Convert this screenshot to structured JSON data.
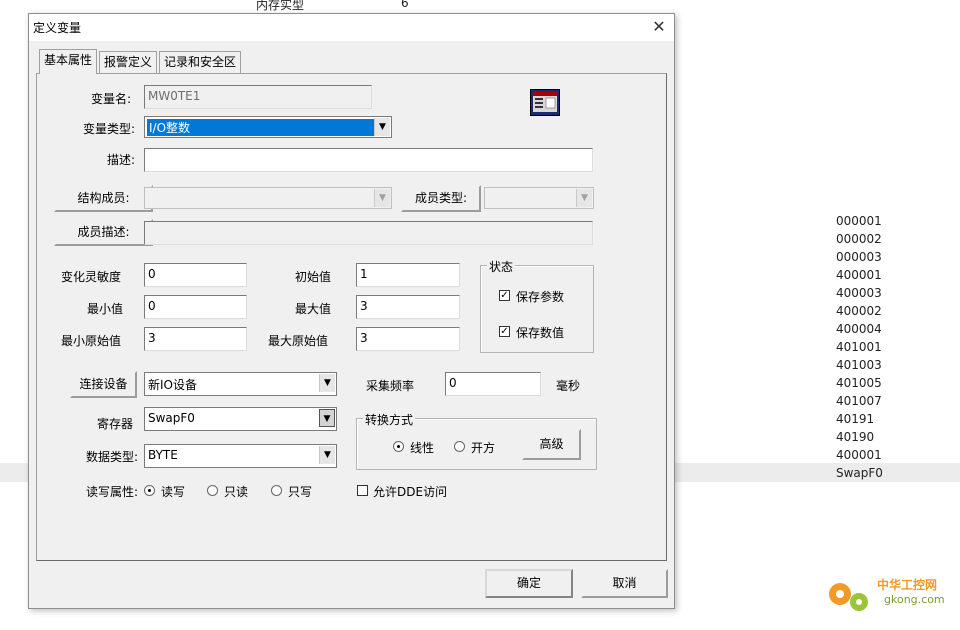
{
  "background": {
    "top_label": "内存实型",
    "top_value": "6",
    "list": [
      "000001",
      "000002",
      "000003",
      "400001",
      "400003",
      "400002",
      "400004",
      "401001",
      "401003",
      "401005",
      "401007",
      "40191",
      "40190",
      "400001",
      "SwapF0"
    ],
    "watermark": "中华工控网 gkong.com"
  },
  "dialog": {
    "title": "定义变量",
    "tabs": [
      "基本属性",
      "报警定义",
      "记录和安全区"
    ],
    "var_name_label": "变量名:",
    "var_name": "MW0TE1",
    "var_type_label": "变量类型:",
    "var_type": "I/O整数",
    "desc_label": "描述:",
    "desc": "",
    "struct_member_label": "结构成员:",
    "member_type_label": "成员类型:",
    "member_desc_label": "成员描述:",
    "sensitivity_label": "变化灵敏度",
    "sensitivity": "0",
    "init_label": "初始值",
    "init": "1",
    "min_label": "最小值",
    "min": "0",
    "max_label": "最大值",
    "max": "3",
    "min_raw_label": "最小原始值",
    "min_raw": "3",
    "max_raw_label": "最大原始值",
    "max_raw": "3",
    "state_group": "状态",
    "save_params": "保存参数",
    "save_value": "保存数值",
    "connect_button": "连接设备",
    "device": "新IO设备",
    "sample_label": "采集频率",
    "sample": "0",
    "ms_label": "毫秒",
    "register_label": "寄存器",
    "register": "SwapF0",
    "convert_group": "转换方式",
    "linear": "线性",
    "sqrt": "开方",
    "advanced_button": "高级",
    "datatype_label": "数据类型:",
    "datatype": "BYTE",
    "rw_label": "读写属性:",
    "rw_options": [
      "读写",
      "只读",
      "只写"
    ],
    "dde_label": "允许DDE访问",
    "ok": "确定",
    "cancel": "取消",
    "close_glyph": "✕"
  }
}
